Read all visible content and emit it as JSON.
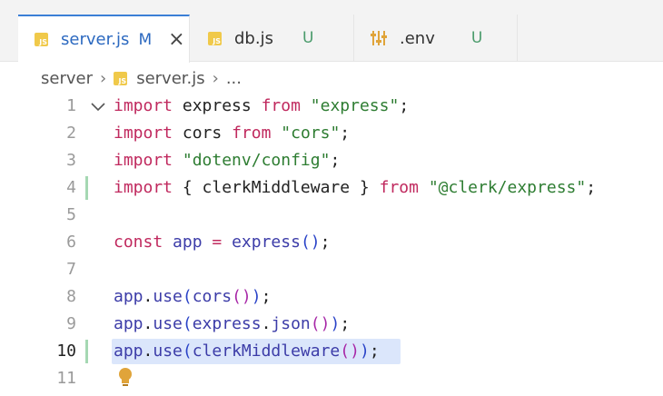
{
  "tabs": [
    {
      "label": "server.js",
      "status": "M",
      "active": true
    },
    {
      "label": "db.js",
      "status": "U",
      "active": false
    },
    {
      "label": ".env",
      "status": "U",
      "active": false
    }
  ],
  "icons": {
    "js_badge": "JS",
    "close": "×"
  },
  "breadcrumb": {
    "folder": "server",
    "file": "server.js",
    "more": "..."
  },
  "lines": [
    {
      "n": "1",
      "tokens": [
        [
          "kw",
          "import"
        ],
        [
          "plain",
          " express "
        ],
        [
          "kw",
          "from"
        ],
        [
          "plain",
          " "
        ],
        [
          "str",
          "\"express\""
        ],
        [
          "plain",
          ";"
        ]
      ]
    },
    {
      "n": "2",
      "tokens": [
        [
          "kw",
          "import"
        ],
        [
          "plain",
          " cors "
        ],
        [
          "kw",
          "from"
        ],
        [
          "plain",
          " "
        ],
        [
          "str",
          "\"cors\""
        ],
        [
          "plain",
          ";"
        ]
      ]
    },
    {
      "n": "3",
      "tokens": [
        [
          "kw",
          "import"
        ],
        [
          "plain",
          " "
        ],
        [
          "str",
          "\"dotenv/config\""
        ],
        [
          "plain",
          ";"
        ]
      ]
    },
    {
      "n": "4",
      "tokens": [
        [
          "kw",
          "import"
        ],
        [
          "plain",
          " { clerkMiddleware } "
        ],
        [
          "kw",
          "from"
        ],
        [
          "plain",
          " "
        ],
        [
          "str",
          "\"@clerk/express\""
        ],
        [
          "plain",
          ";"
        ]
      ]
    },
    {
      "n": "5",
      "tokens": []
    },
    {
      "n": "6",
      "tokens": [
        [
          "kw",
          "const"
        ],
        [
          "plain",
          " "
        ],
        [
          "fn",
          "app"
        ],
        [
          "plain",
          " "
        ],
        [
          "kw",
          "="
        ],
        [
          "plain",
          " "
        ],
        [
          "fn",
          "express"
        ],
        [
          "p1",
          "()"
        ],
        [
          "plain",
          ";"
        ]
      ]
    },
    {
      "n": "7",
      "tokens": []
    },
    {
      "n": "8",
      "tokens": [
        [
          "fn",
          "app"
        ],
        [
          "plain",
          "."
        ],
        [
          "fn",
          "use"
        ],
        [
          "p1",
          "("
        ],
        [
          "fn",
          "cors"
        ],
        [
          "p2",
          "()"
        ],
        [
          "p1",
          ")"
        ],
        [
          "plain",
          ";"
        ]
      ]
    },
    {
      "n": "9",
      "tokens": [
        [
          "fn",
          "app"
        ],
        [
          "plain",
          "."
        ],
        [
          "fn",
          "use"
        ],
        [
          "p1",
          "("
        ],
        [
          "fn",
          "express"
        ],
        [
          "plain",
          "."
        ],
        [
          "fn",
          "json"
        ],
        [
          "p2",
          "()"
        ],
        [
          "p1",
          ")"
        ],
        [
          "plain",
          ";"
        ]
      ]
    },
    {
      "n": "10",
      "tokens": [
        [
          "fn",
          "app"
        ],
        [
          "plain",
          "."
        ],
        [
          "fn",
          "use"
        ],
        [
          "p1",
          "("
        ],
        [
          "fn",
          "clerkMiddleware"
        ],
        [
          "p2",
          "()"
        ],
        [
          "p1",
          ")"
        ],
        [
          "plain",
          ";"
        ]
      ]
    },
    {
      "n": "11",
      "tokens": []
    }
  ],
  "colors": {
    "accent": "#3b7fd6",
    "modified": "#2c69c0",
    "untracked": "#4a9b6b",
    "selection": "#dbe6fb"
  }
}
